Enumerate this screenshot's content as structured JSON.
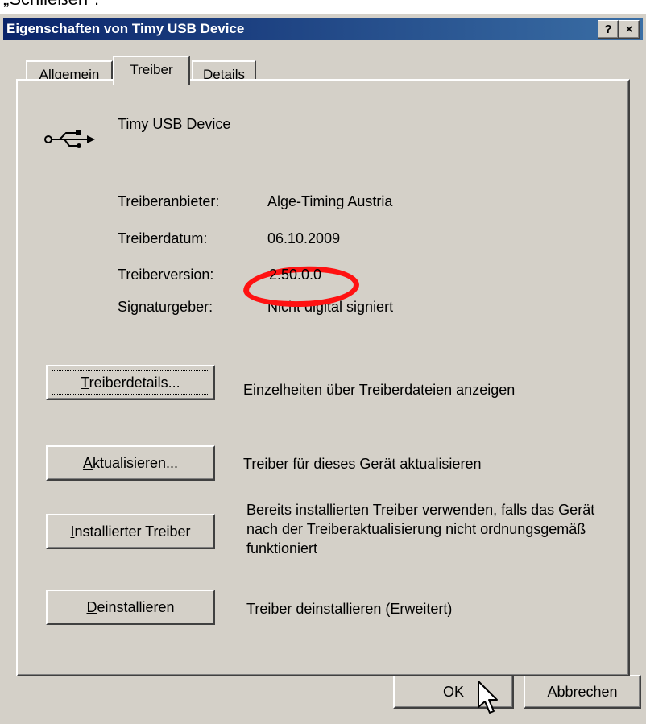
{
  "caption": "„Schließen\".",
  "window": {
    "title": "Eigenschaften von Timy USB Device",
    "help_label": "?",
    "close_label": "×"
  },
  "tabs": [
    {
      "label": "Allgemein",
      "active": false
    },
    {
      "label": "Treiber",
      "active": true
    },
    {
      "label": "Details",
      "active": false
    }
  ],
  "device": {
    "icon": "usb-icon",
    "name": "Timy USB Device"
  },
  "info": [
    {
      "label": "Treiberanbieter:",
      "value": "Alge-Timing Austria"
    },
    {
      "label": "Treiberdatum:",
      "value": "06.10.2009"
    },
    {
      "label": "Treiberversion:",
      "value": "2.50.0.0"
    },
    {
      "label": "Signaturgeber:",
      "value": "Nicht digital signiert"
    }
  ],
  "actions": [
    {
      "button": "Treiberdetails...",
      "accel": "T",
      "rest": "reiberdetails...",
      "description": "Einzelheiten über Treiberdateien anzeigen"
    },
    {
      "button": "Aktualisieren...",
      "accel": "A",
      "rest": "ktualisieren...",
      "description": "Treiber für dieses Gerät aktualisieren"
    },
    {
      "button": "Installierter Treiber",
      "accel": "I",
      "rest": "nstallierter Treiber",
      "description": "Bereits installierten Treiber verwenden, falls das Gerät nach der Treiberaktualisierung nicht ordnungsgemäß funktioniert"
    },
    {
      "button": "Deinstallieren",
      "accel": "D",
      "rest": "einstallieren",
      "description": "Treiber deinstallieren (Erweitert)"
    }
  ],
  "footer": {
    "ok_label": "OK",
    "cancel_label": "Abbrechen"
  },
  "colors": {
    "titlebar_start": "#0a246a",
    "titlebar_end": "#3a6ea5",
    "face": "#d4d0c8",
    "highlight_mark": "#ff1212"
  }
}
